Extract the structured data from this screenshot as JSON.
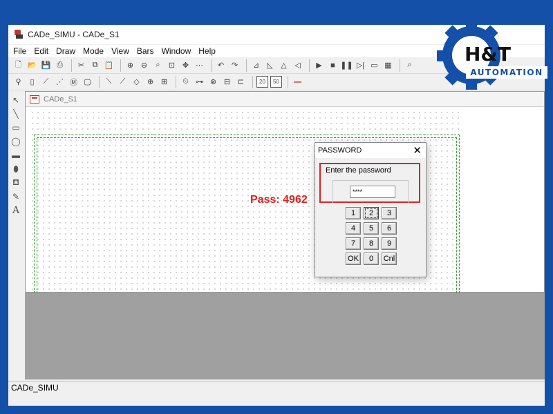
{
  "window": {
    "title": "CADe_SIMU - CADe_S1"
  },
  "menu": [
    "File",
    "Edit",
    "Draw",
    "Mode",
    "View",
    "Bars",
    "Window",
    "Help"
  ],
  "toolbar1": [
    "new-icon",
    "open-icon",
    "save-icon",
    "print-icon",
    "cut-icon",
    "copy-icon",
    "paste-icon",
    "zoom-icon",
    "undo-icon",
    "redo-icon",
    "play-icon",
    "stop-icon",
    "pause-icon",
    "step-icon"
  ],
  "toolbar2": [
    "ground-icon",
    "switch-icon",
    "contact-icon",
    "coil-icon",
    "relay-icon",
    "module-icon"
  ],
  "toolbar2_labels": {
    "z20": "20",
    "z50": "50"
  },
  "left_tools": [
    "arrow-icon",
    "line-icon",
    "rect-icon",
    "ellipse-icon",
    "filled-rect-icon",
    "filled-ellipse-icon",
    "fill-icon",
    "pen-icon",
    "text-icon"
  ],
  "left_text_tool": "A",
  "child_window": {
    "title": "CADe_S1"
  },
  "canvas": {
    "annotation": "Pass: 4962"
  },
  "dialog": {
    "title": "PASSWORD",
    "label": "Enter the password",
    "value": "****",
    "keys": [
      "1",
      "2",
      "3",
      "4",
      "5",
      "6",
      "7",
      "8",
      "9",
      "OK",
      "0",
      "Cnl"
    ]
  },
  "statusbar": {
    "text": "CADe_SIMU"
  },
  "logo": {
    "line1": "H&T",
    "line2": "AUTOMATION"
  },
  "colors": {
    "frame": "#1450a8",
    "highlight": "#e02020",
    "schematic_border": "#2f9e2f"
  }
}
